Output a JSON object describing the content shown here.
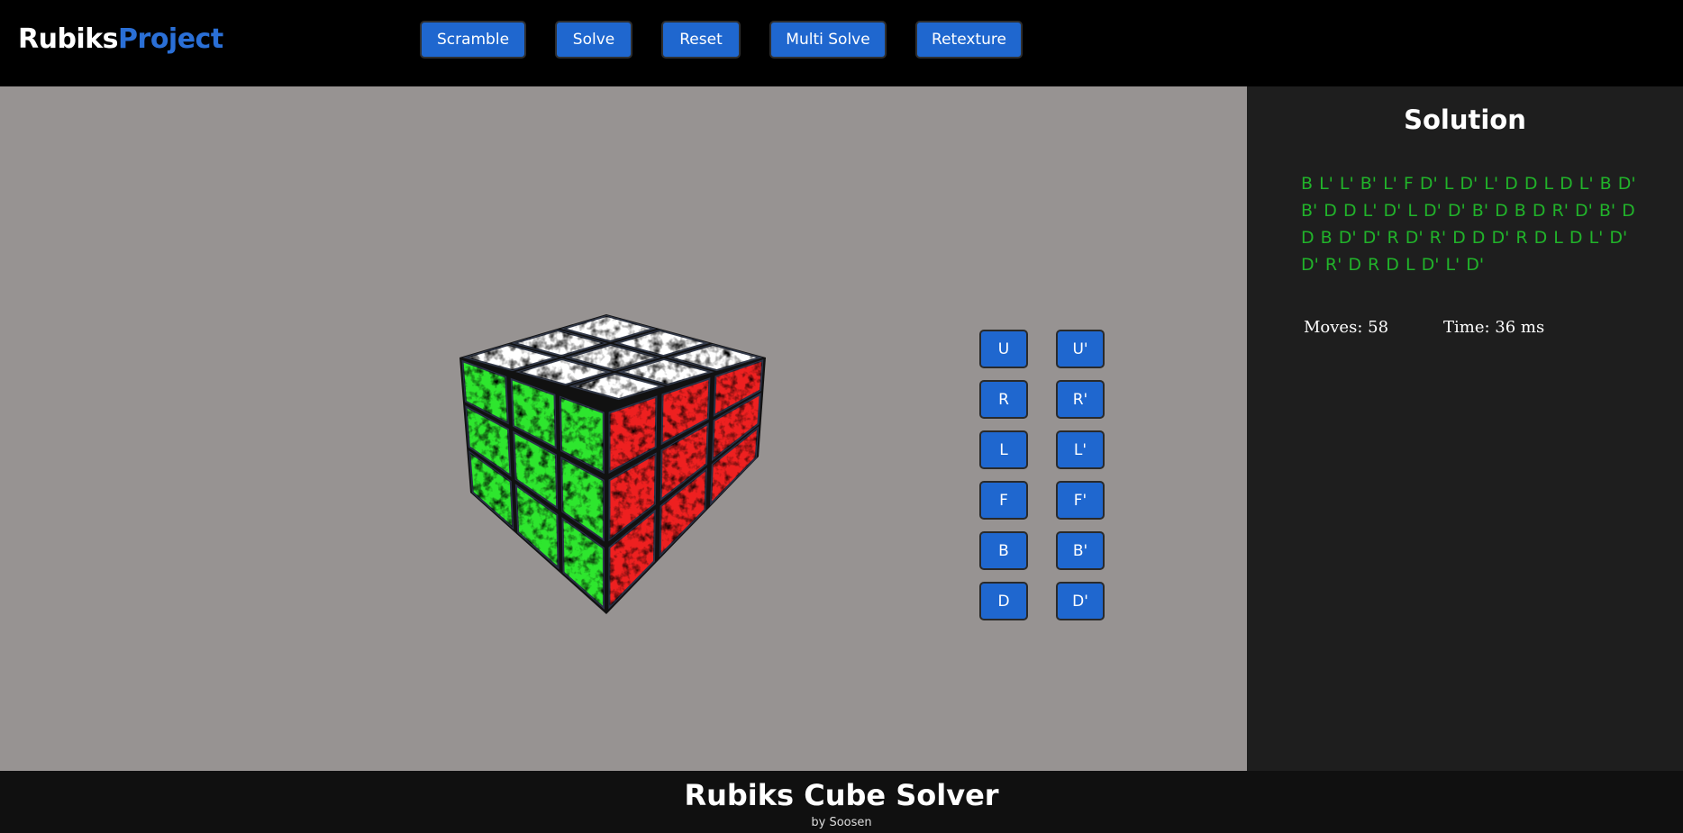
{
  "logo": {
    "part1": "Rubiks",
    "part2": "Project"
  },
  "toolbar": {
    "scramble": "Scramble",
    "solve": "Solve",
    "reset": "Reset",
    "multi_solve": "Multi Solve",
    "retexture": "Retexture"
  },
  "moves": {
    "u": "U",
    "u_prime": "U'",
    "r": "R",
    "r_prime": "R'",
    "l": "L",
    "l_prime": "L'",
    "f": "F",
    "f_prime": "F'",
    "b": "B",
    "b_prime": "B'",
    "d": "D",
    "d_prime": "D'"
  },
  "panel": {
    "title": "Solution",
    "solution": "B L' L' B' L' F D' L D' L' D D L D L' B D' B' D D L' D' L D' D' B' D B D R' D' B' D D B D' D' R D' R' D D D' R D L D L' D' D' R' D R D L D' L' D'",
    "moves": "Moves: 58",
    "time": "Time: 36 ms"
  },
  "cube": {
    "top_color": "#ffffff",
    "left_color": "#2ee62e",
    "right_color": "#ee2020"
  },
  "footer": {
    "title": "Rubiks Cube Solver",
    "by": "by Soosen"
  }
}
